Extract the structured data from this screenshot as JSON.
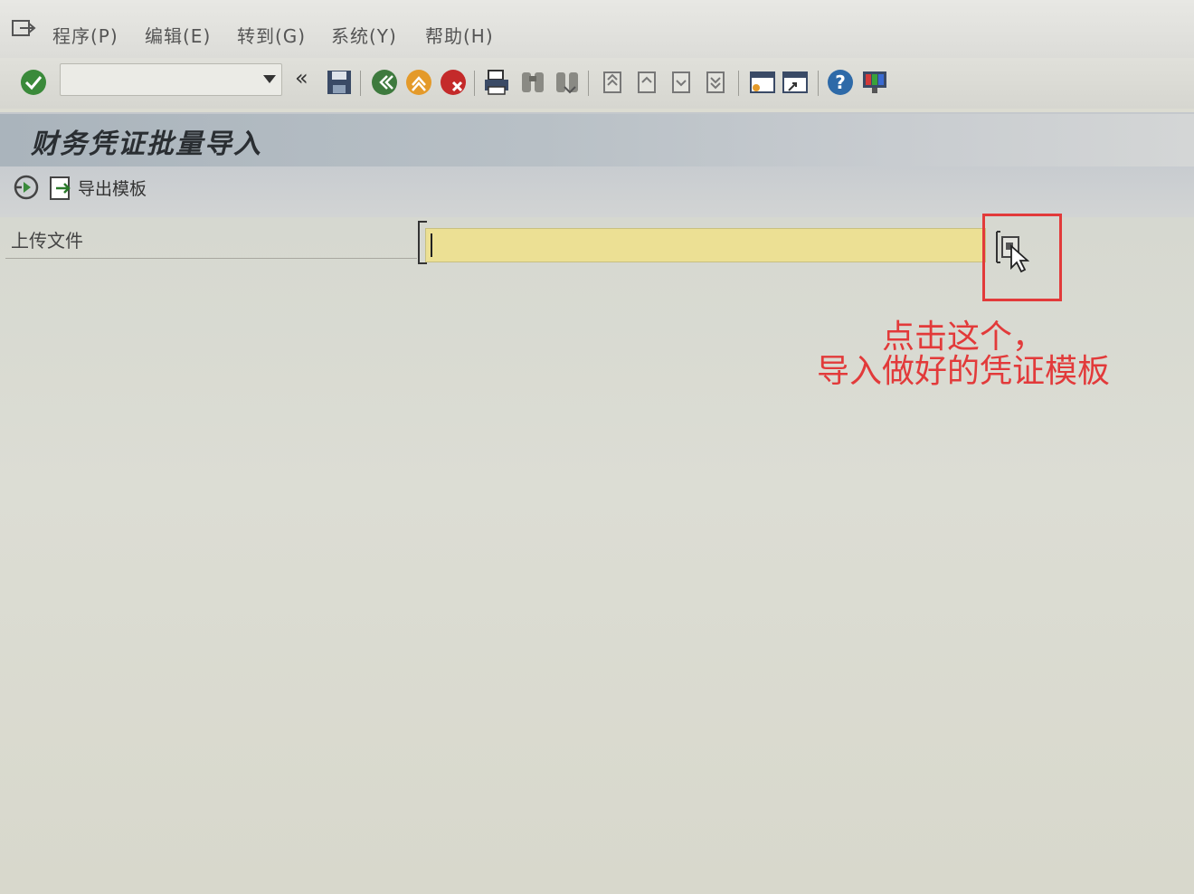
{
  "menubar": {
    "items": [
      {
        "label": "程序(P)"
      },
      {
        "label": "编辑(E)"
      },
      {
        "label": "转到(G)"
      },
      {
        "label": "系统(Y)"
      },
      {
        "label": "帮助(H)"
      }
    ]
  },
  "toolbar": {
    "command_field_value": "",
    "collapse_symbol": "«"
  },
  "page": {
    "title": "财务凭证批量导入"
  },
  "app_toolbar": {
    "export_template_label": "导出模板"
  },
  "form": {
    "upload_label": "上传文件",
    "upload_value": ""
  },
  "annotation": {
    "line1": "点击这个，",
    "line2": "导入做好的凭证模板",
    "color": "#e23a3a"
  }
}
